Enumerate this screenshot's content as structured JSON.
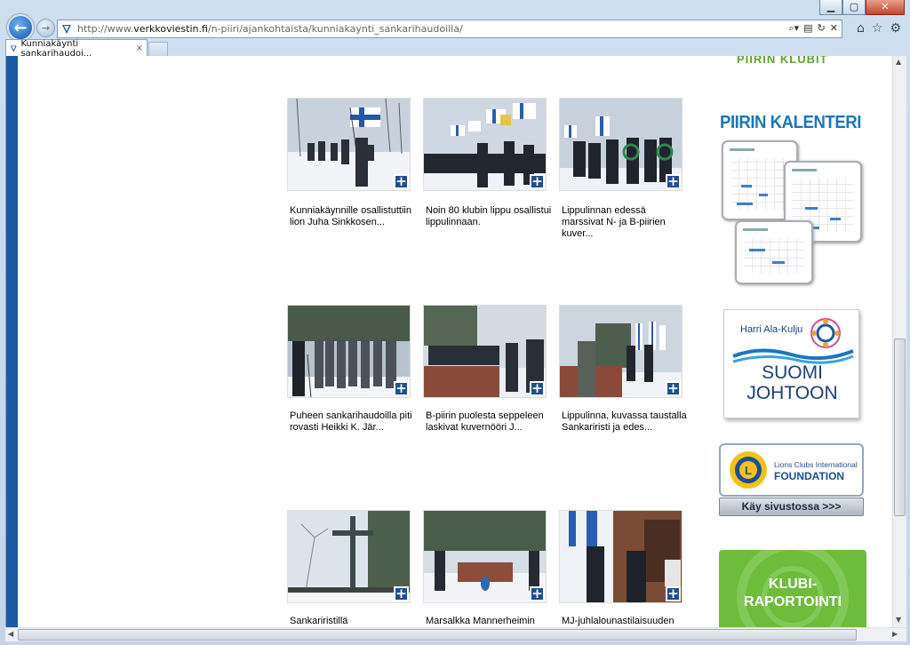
{
  "browser": {
    "url_gray_prefix": "http://www.",
    "url_domain": "verkkoviestin.fi",
    "url_path": "/n-piiri/ajankohtaista/kunniakaynti_sankarihaudoilla/",
    "tab_title": "Kunniakäynti sankarihaudoi...",
    "tab_close": "×"
  },
  "gallery": [
    {
      "caption": "Kunniakäynnille osallistuttiin lion Juha Sinkkosen..."
    },
    {
      "caption": "Noin 80 klubin lippu osallistui lippulinnaan."
    },
    {
      "caption": "Lippulinnan edessä marssivat N- ja B-piirien kuver..."
    },
    {
      "caption": "Puheen sankarihaudoilla piti rovasti Heikki K. Jär..."
    },
    {
      "caption": "B-piirin puolesta seppeleen laskivat kuvernööri J..."
    },
    {
      "caption": "Lippulinna, kuvassa taustalla Sankariristi ja edes..."
    },
    {
      "caption": "Sankariristillä"
    },
    {
      "caption": "Marsalkka Mannerheimin"
    },
    {
      "caption": "MJ-juhlalounastilaisuuden"
    }
  ],
  "plus_symbol": "+",
  "sidebar": {
    "club_heading": "PIIRIN KLUBIT",
    "calendar_heading": "PIIRIN KALENTERI",
    "harri_name": "Harri Ala-Kulju",
    "harri_line1": "SUOMI",
    "harri_line2": "JOHTOON",
    "lions_line1": "Lions Clubs International",
    "lions_line2": "FOUNDATION",
    "lions_button": "Käy sivustossa >>>",
    "klubi_line1": "KLUBI-",
    "klubi_line2": "RAPORTOINTI"
  },
  "colors": {
    "accent_blue": "#1c5aa3",
    "green": "#6dbc3c",
    "calendar_blue": "#1a76bd"
  }
}
